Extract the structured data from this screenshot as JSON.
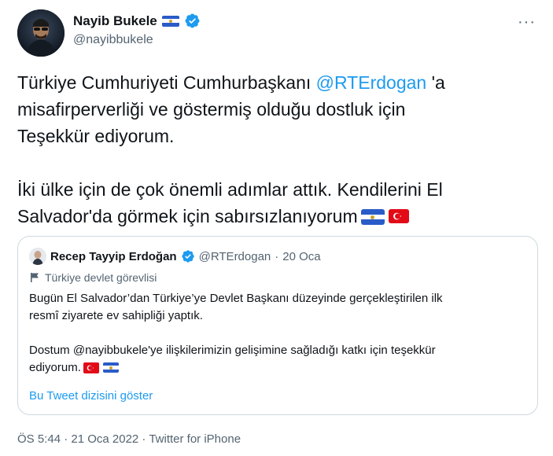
{
  "author": {
    "name": "Nayib Bukele",
    "handle": "@nayibbukele"
  },
  "tweet": {
    "line1_pre": "Türkiye Cumhuriyeti Cumhurbaşkanı ",
    "mention": "@RTErdogan",
    "line1_post": " 'a",
    "line2": "misafirperverliği ve göstermiş olduğu dostluk için",
    "line3": "Teşekkür ediyorum.",
    "line4": "İki ülke için de çok önemli adımlar attık. Kendilerini El",
    "line5": "Salvador'da görmek için sabırsızlanıyorum"
  },
  "quote": {
    "name": "Recep Tayyip Erdoğan",
    "handle": "@RTErdogan",
    "dot": "·",
    "date": "20 Oca",
    "label": "Türkiye devlet görevlisi",
    "para1_line1": "Bugün El Salvador’dan Türkiye’ye Devlet Başkanı düzeyinde gerçekleştirilen ilk",
    "para1_line2": "resmî ziyarete ev sahipliği yaptık.",
    "para2_line1": "Dostum @nayibbukele'ye ilişkilerimizin gelişimine sağladığı katkı için teşekkür",
    "para2_line2": "ediyorum.",
    "show_thread": "Bu Tweet dizisini göster"
  },
  "footer": {
    "meta": "ÖS 5:44 · 21 Oca 2022 · Twitter for iPhone"
  },
  "colors": {
    "link": "#1d9bf0",
    "muted": "#536471",
    "text": "#0f1419",
    "border": "#cfd9de"
  },
  "icons": [
    "more-icon",
    "verified-badge-icon",
    "el-salvador-flag-icon",
    "turkey-flag-icon",
    "government-flag-icon"
  ]
}
